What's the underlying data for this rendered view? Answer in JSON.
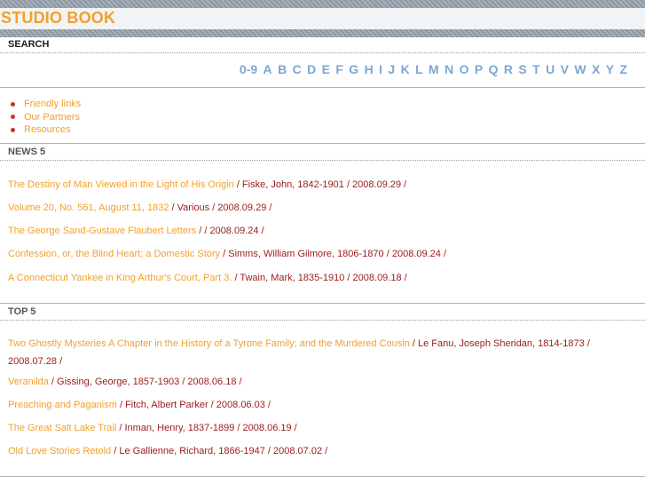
{
  "brand": {
    "title": "STUDIO BOOK"
  },
  "search": {
    "title": "SEARCH",
    "letters": [
      "0-9",
      "A",
      "B",
      "C",
      "D",
      "E",
      "F",
      "G",
      "H",
      "I",
      "J",
      "K",
      "L",
      "M",
      "N",
      "O",
      "P",
      "Q",
      "R",
      "S",
      "T",
      "U",
      "V",
      "W",
      "X",
      "Y",
      "Z"
    ]
  },
  "links": [
    "Friendly links",
    "Our Partners",
    "Resources"
  ],
  "news": {
    "title": "NEWS 5",
    "items": [
      {
        "title": "The Destiny of Man Viewed in the Light of His Origin",
        "meta": " / Fiske, John, 1842-1901 / 2008.09.29 /"
      },
      {
        "title": "Volume 20, No. 561, August 11, 1832",
        "meta": " / Various / 2008.09.29 /"
      },
      {
        "title": "The George Sand-Gustave Flaubert Letters",
        "meta": " / / 2008.09.24 /"
      },
      {
        "title": "Confession, or, the Blind Heart; a Domestic Story",
        "meta": " / Simms, William Gilmore, 1806-1870 / 2008.09.24 /"
      },
      {
        "title": "A Connecticut Yankee in King Arthur's Court, Part 3.",
        "meta": " / Twain, Mark, 1835-1910 / 2008.09.18 /"
      }
    ]
  },
  "top": {
    "title": "TOP 5",
    "items": [
      {
        "title": "Two Ghostly Mysteries A Chapter in the History of a Tyrone Family; and the Murdered Cousin",
        "meta": " / Le Fanu, Joseph Sheridan, 1814-1873 / 2008.07.28 /"
      },
      {
        "title": "Veranilda",
        "meta": " / Gissing, George, 1857-1903 / 2008.06.18 /"
      },
      {
        "title": "Preaching and Paganism",
        "meta": " / Fitch, Albert Parker / 2008.06.03 /"
      },
      {
        "title": "The Great Salt Lake Trail",
        "meta": " / Inman, Henry, 1837-1899 / 2008.06.19 /"
      },
      {
        "title": "Old Love Stories Retold",
        "meta": " / Le Gallienne, Richard, 1866-1947 / 2008.07.02 /"
      }
    ]
  }
}
